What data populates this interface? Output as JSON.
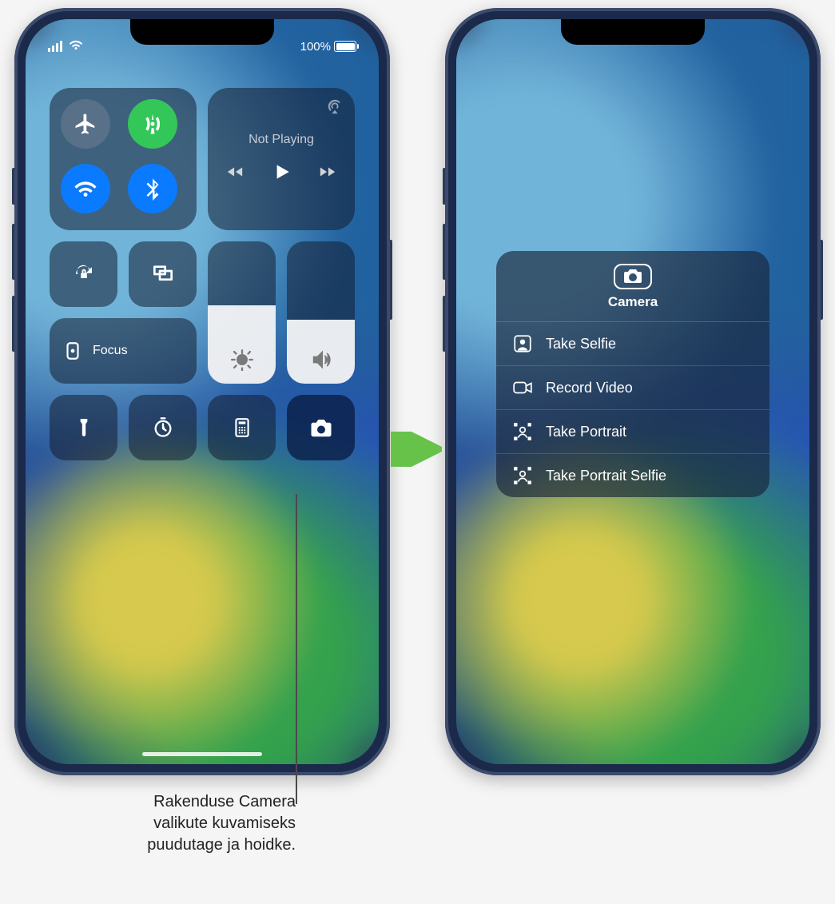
{
  "status": {
    "battery_pct": "100%"
  },
  "connectivity": {
    "airplane": "airplane-icon",
    "cellular": "cellular-icon",
    "wifi": "wifi-icon",
    "bluetooth": "bluetooth-icon"
  },
  "media": {
    "title": "Not Playing",
    "airplay_icon": "airplay-icon"
  },
  "tiles": {
    "orientation_lock": "orientation-lock-icon",
    "screen_mirroring": "screen-mirroring-icon",
    "focus_label": "Focus",
    "flashlight": "flashlight-icon",
    "timer": "timer-icon",
    "calculator": "calculator-icon",
    "camera": "camera-icon"
  },
  "sliders": {
    "brightness_pct": 55,
    "volume_pct": 45
  },
  "camera_menu": {
    "title": "Camera",
    "items": [
      {
        "label": "Take Selfie",
        "icon": "selfie-icon"
      },
      {
        "label": "Record Video",
        "icon": "video-icon"
      },
      {
        "label": "Take Portrait",
        "icon": "portrait-icon"
      },
      {
        "label": "Take Portrait Selfie",
        "icon": "portrait-selfie-icon"
      }
    ]
  },
  "callout": {
    "line1": "Rakenduse Camera",
    "line2": "valikute kuvamiseks",
    "line3": "puudutage ja hoidke."
  }
}
